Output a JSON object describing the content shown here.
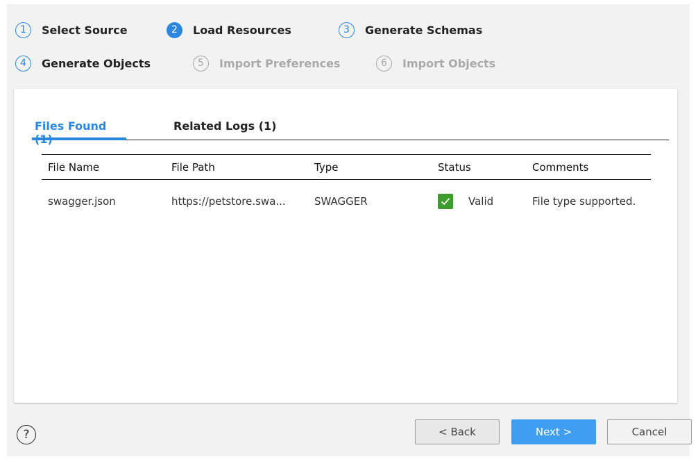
{
  "wizard": {
    "steps": [
      {
        "number": "1",
        "label": "Select Source",
        "state": "completed"
      },
      {
        "number": "2",
        "label": "Load Resources",
        "state": "active"
      },
      {
        "number": "3",
        "label": "Generate Schemas",
        "state": "completed"
      },
      {
        "number": "4",
        "label": "Generate Objects",
        "state": "completed"
      },
      {
        "number": "5",
        "label": "Import Preferences",
        "state": "disabled"
      },
      {
        "number": "6",
        "label": "Import Objects",
        "state": "disabled"
      }
    ]
  },
  "tabs": [
    {
      "label": "Files Found (1)",
      "active": true
    },
    {
      "label": "Related Logs (1)",
      "active": false
    }
  ],
  "table": {
    "columns": [
      "File Name",
      "File Path",
      "Type",
      "Status",
      "Comments"
    ],
    "rows": [
      {
        "file_name": "swagger.json",
        "file_path": "https://petstore.swa...",
        "type": "SWAGGER",
        "status": "Valid",
        "comments": "File type supported."
      }
    ]
  },
  "footer": {
    "help_icon": "?",
    "back_label": "< Back",
    "next_label": "Next >",
    "cancel_label": "Cancel"
  },
  "colors": {
    "accent": "#2b86e0",
    "next_button": "#3f9ef0",
    "valid_check": "#3d9c2b",
    "disabled_step": "#a9a9a9"
  },
  "icons": {
    "valid": "check-icon",
    "help": "help-circle-icon"
  }
}
